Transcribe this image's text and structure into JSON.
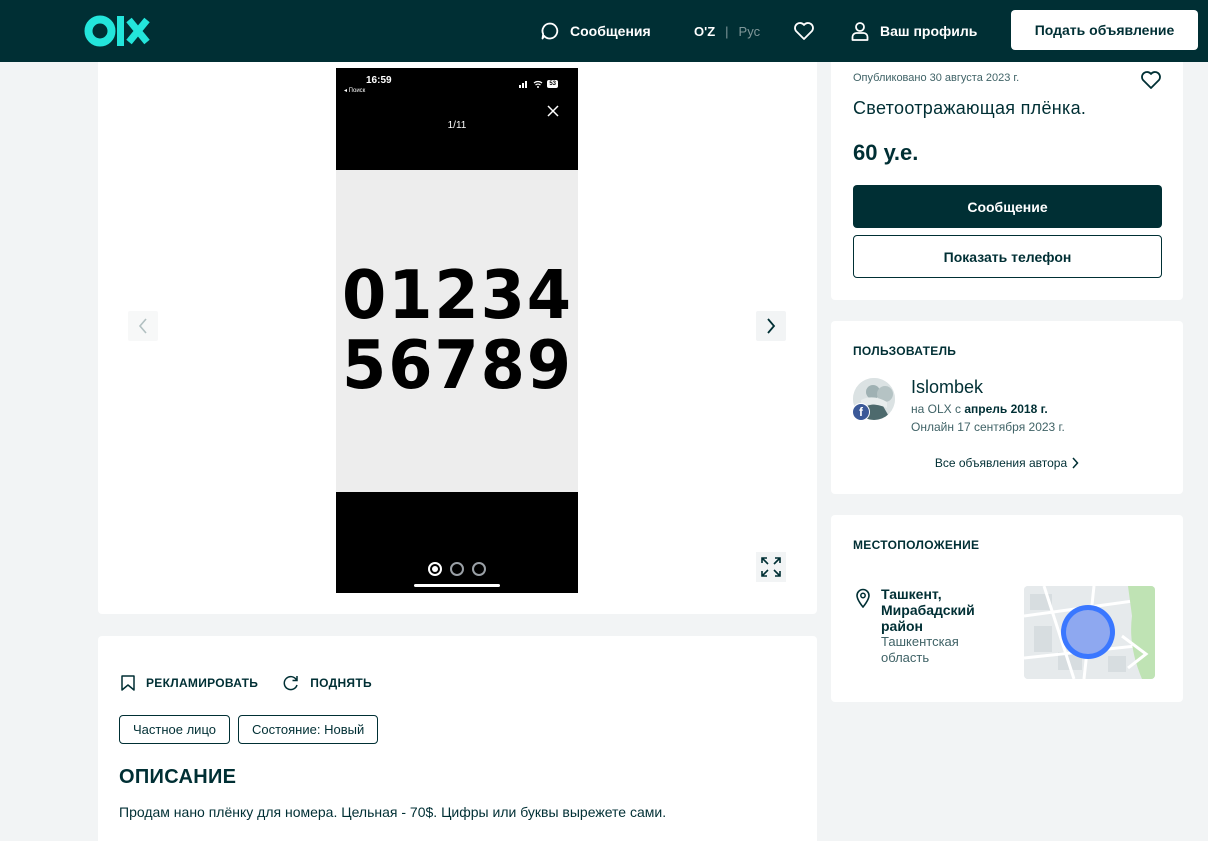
{
  "header": {
    "logo_alt": "olx",
    "messages_label": "Сообщения",
    "lang_uz": "O'Z",
    "lang_sep": "|",
    "lang_ru": "Рус",
    "profile_label": "Ваш профиль",
    "post_ad_label": "Подать объявление"
  },
  "gallery": {
    "phone_time": "16:59",
    "phone_back": "◂ Поиск",
    "phone_battery": "53",
    "counter": "1/11",
    "digits_line1": "01234",
    "digits_line2": "56789",
    "dots_count": 3,
    "active_dot": 0
  },
  "details": {
    "promote_label": "РЕКЛАМИРОВАТЬ",
    "raise_label": "ПОДНЯТЬ",
    "tags": [
      "Частное лицо",
      "Состояние: Новый"
    ],
    "description_title": "ОПИСАНИЕ",
    "description_text": "Продам нано плёнку для номера. Цельная - 70$. Цифры или буквы вырежете сами."
  },
  "ad": {
    "published": "Опубликовано 30 августа 2023 г.",
    "title": "Светоотражающая плёнка.",
    "price": "60 у.е.",
    "message_button": "Сообщение",
    "phone_button": "Показать телефон"
  },
  "user": {
    "section_title": "ПОЛЬЗОВАТЕЛЬ",
    "name": "Islombek",
    "since_prefix": "на OLX с ",
    "since_date": "апрель 2018 г.",
    "online": "Онлайн 17 сентября 2023 г.",
    "all_ads_link": "Все объявления автора",
    "badge": "f"
  },
  "location": {
    "section_title": "МЕСТОПОЛОЖЕНИЕ",
    "city": "Ташкент, Мирабадский район",
    "region": "Ташкентская область"
  },
  "colors": {
    "brand_dark": "#002f34",
    "brand_accent": "#23e5db",
    "map_circle": "#3a77ff"
  }
}
